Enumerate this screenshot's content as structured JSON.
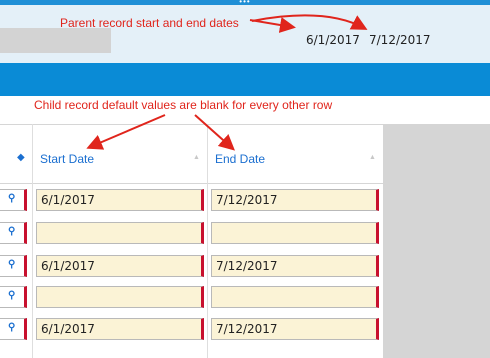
{
  "parent": {
    "start_date": "6/1/2017",
    "end_date": "7/12/2017"
  },
  "annotations": {
    "parent_note": "Parent record start and end dates",
    "child_note": "Child record default values are blank for every other row"
  },
  "grid": {
    "columns": [
      {
        "label": "Start Date"
      },
      {
        "label": "End Date"
      }
    ],
    "rows": [
      {
        "start": "6/1/2017",
        "end": "7/12/2017"
      },
      {
        "start": "",
        "end": ""
      },
      {
        "start": "6/1/2017",
        "end": "7/12/2017"
      },
      {
        "start": "",
        "end": ""
      },
      {
        "start": "6/1/2017",
        "end": "7/12/2017"
      }
    ]
  },
  "icons": {
    "lookup": "search-icon",
    "sort": "sort-icon"
  },
  "colors": {
    "accent_blue": "#0a8bd6",
    "annotation_red": "#e0251c",
    "required_red": "#c8102e",
    "cell_fill": "#fbf3d6"
  }
}
